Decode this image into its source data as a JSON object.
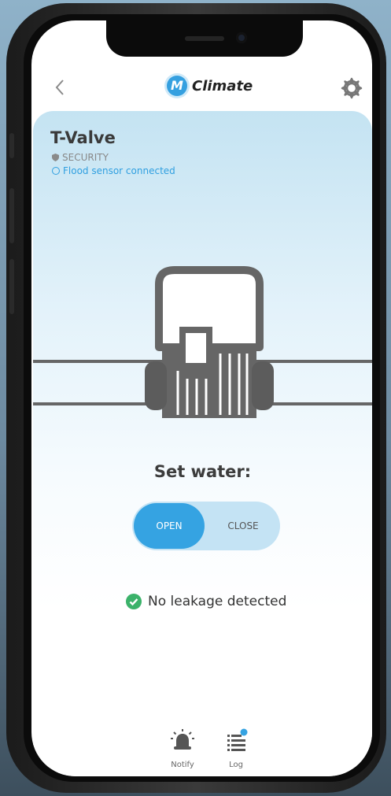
{
  "header": {
    "back_icon": "chevron-left-icon",
    "logo_letter": "M",
    "app_title": "Climate",
    "settings_icon": "gear-icon"
  },
  "device": {
    "title": "T-Valve",
    "category": "SECURITY",
    "status": "Flood sensor connected"
  },
  "control": {
    "heading": "Set water:",
    "open_label": "OPEN",
    "close_label": "CLOSE",
    "selected": "OPEN"
  },
  "leak": {
    "message": "No leakage detected"
  },
  "nav": {
    "items": [
      {
        "label": "Notify",
        "icon": "alarm-icon"
      },
      {
        "label": "Log",
        "icon": "list-icon"
      }
    ]
  },
  "colors": {
    "accent": "#35a3e2",
    "success": "#3bb26a",
    "card_top": "#c4e3f2"
  }
}
